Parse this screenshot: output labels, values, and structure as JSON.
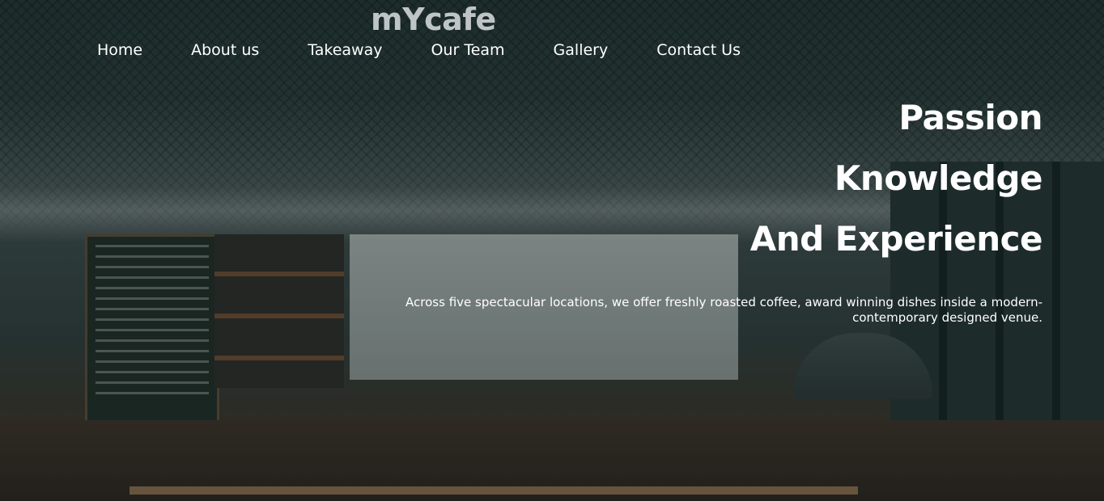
{
  "brand": {
    "name": "mYcafe"
  },
  "nav": {
    "items": [
      {
        "label": "Home"
      },
      {
        "label": "About us"
      },
      {
        "label": "Takeaway"
      },
      {
        "label": "Our Team"
      },
      {
        "label": "Gallery"
      },
      {
        "label": "Contact Us"
      }
    ]
  },
  "hero": {
    "headline_lines": [
      "Passion",
      "Knowledge",
      "And Experience"
    ],
    "tagline": "Across five spectacular locations, we offer freshly roasted coffee, award winning dishes inside a modern-contemporary designed venue."
  }
}
